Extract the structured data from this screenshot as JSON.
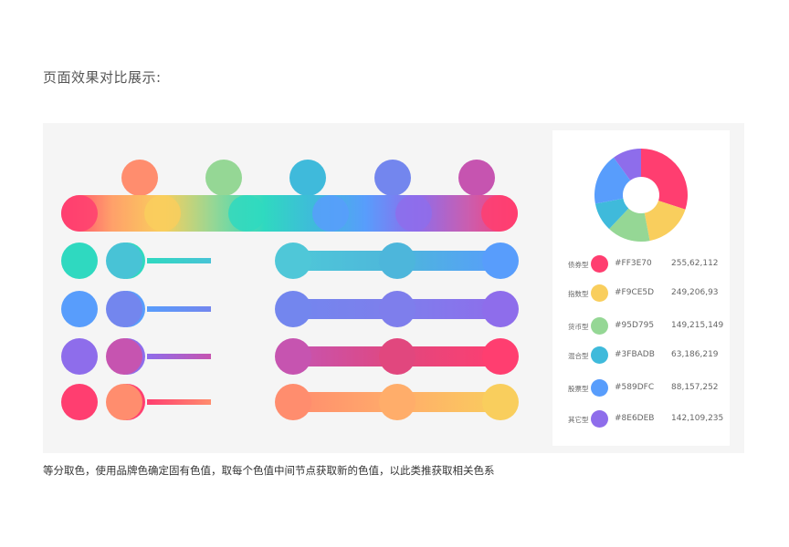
{
  "page_title": "页面效果对比展示:",
  "caption": "等分取色，使用品牌色确定固有色值，取每个色值中间节点获取新的色值，以此类推获取相关色系",
  "brand_colors": [
    {
      "label": "债券型",
      "hex": "#FF3E70",
      "rgb": "255,62,112"
    },
    {
      "label": "指数型",
      "hex": "#F9CE5D",
      "rgb": "249,206,93"
    },
    {
      "label": "货币型",
      "hex": "#95D795",
      "rgb": "149,215,149"
    },
    {
      "label": "混合型",
      "hex": "#3FBADB",
      "rgb": "63,186,219"
    },
    {
      "label": "股票型",
      "hex": "#589DFC",
      "rgb": "88,157,252"
    },
    {
      "label": "其它型",
      "hex": "#8E6DEB",
      "rgb": "142,109,235"
    }
  ],
  "donut_shares": [
    0.3,
    0.17,
    0.15,
    0.1,
    0.18,
    0.1
  ],
  "top_circles": [
    "#FF8D6E",
    "#95D795",
    "#3FBADB",
    "#7386EE",
    "#C654B0"
  ],
  "main_bar": {
    "gradient": [
      "#FF3E70",
      "#FFA06A",
      "#F9CE5D",
      "#95D795",
      "#2FD9C0",
      "#3FBADB",
      "#589DFC",
      "#8E6DEB",
      "#C95EB0",
      "#FF3E70"
    ],
    "knots": [
      "#FF3E70",
      "#F9CE5D",
      "#2FD9C0",
      "#589DFC",
      "#8E6DEB",
      "#FF3E70"
    ]
  },
  "small_rows": [
    {
      "a": "#2FD9C0",
      "b": "#48C3D6",
      "line": [
        "#2FD9C0",
        "#48C3D6"
      ]
    },
    {
      "a": "#589DFC",
      "b": "#7386EE",
      "line": [
        "#589DFC",
        "#7386EE"
      ]
    },
    {
      "a": "#8E6DEB",
      "b": "#C654B0",
      "line": [
        "#8E6DEB",
        "#C654B0"
      ]
    },
    {
      "a": "#FF3E70",
      "b": "#FF8D6E",
      "line": [
        "#FF3E70",
        "#FF8D6E"
      ]
    }
  ],
  "right_rows": [
    {
      "dots": [
        "#4FC7D8",
        "#4DB6DB",
        "#589DFC"
      ]
    },
    {
      "dots": [
        "#7386EE",
        "#7E7EEC",
        "#8E6DEB"
      ]
    },
    {
      "dots": [
        "#C654B0",
        "#E1477E",
        "#FF3E70"
      ]
    },
    {
      "dots": [
        "#FF8D6E",
        "#FFAD6A",
        "#F9CE5D"
      ]
    }
  ]
}
